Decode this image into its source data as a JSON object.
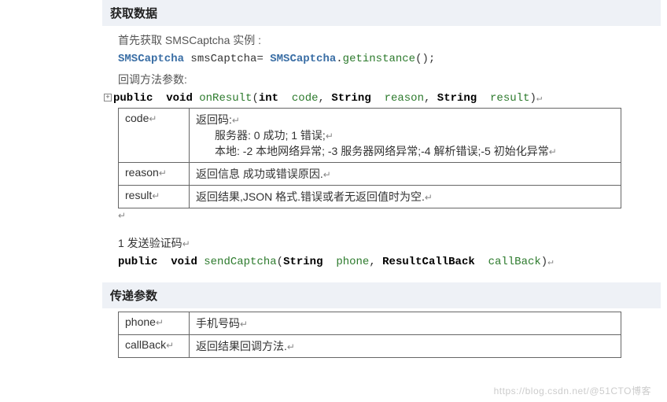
{
  "section1": {
    "title": "获取数据",
    "intro": "首先获取 SMSCaptcha 实例 :",
    "code": {
      "cls": "SMSCaptcha",
      "var": "smsCaptcha",
      "eq": "=",
      "cls2": "SMSCaptcha",
      "dot": ".",
      "call": "getinstance",
      "paren": "();"
    },
    "callback_label": "回调方法参数:",
    "signature": {
      "public": "public",
      "void": "void",
      "method": "onResult",
      "open": "(",
      "int": "int",
      "p1": "code",
      "c": ",",
      "String": "String",
      "p2": "reason",
      "p3": "result",
      "close": ")"
    },
    "table": {
      "r1k": "code",
      "r1v_a": "返回码:",
      "r1v_b": "服务器: 0  成功; 1  错误;",
      "r1v_c": "本地: -2 本地网络异常;  -3  服务器网络异常;-4  解析错误;-5  初始化异常",
      "r2k": "reason",
      "r2v": "返回信息  成功或错误原因.",
      "r3k": "result",
      "r3v": "返回结果,JSON 格式.错误或者无返回值时为空."
    }
  },
  "section2": {
    "title": "1 发送验证码",
    "signature": {
      "public": "public",
      "void": "void",
      "method": "sendCaptcha",
      "open": "(",
      "String": "String",
      "p1": "phone",
      "c": ",",
      "RCB": "ResultCallBack",
      "p2": "callBack",
      "close": ")"
    }
  },
  "section3": {
    "title": "传递参数",
    "table": {
      "r1k": "phone",
      "r1v": "手机号码",
      "r2k": "callBack",
      "r2v": "返回结果回调方法."
    }
  },
  "watermark": "https://blog.csdn.net/@51CTO博客"
}
